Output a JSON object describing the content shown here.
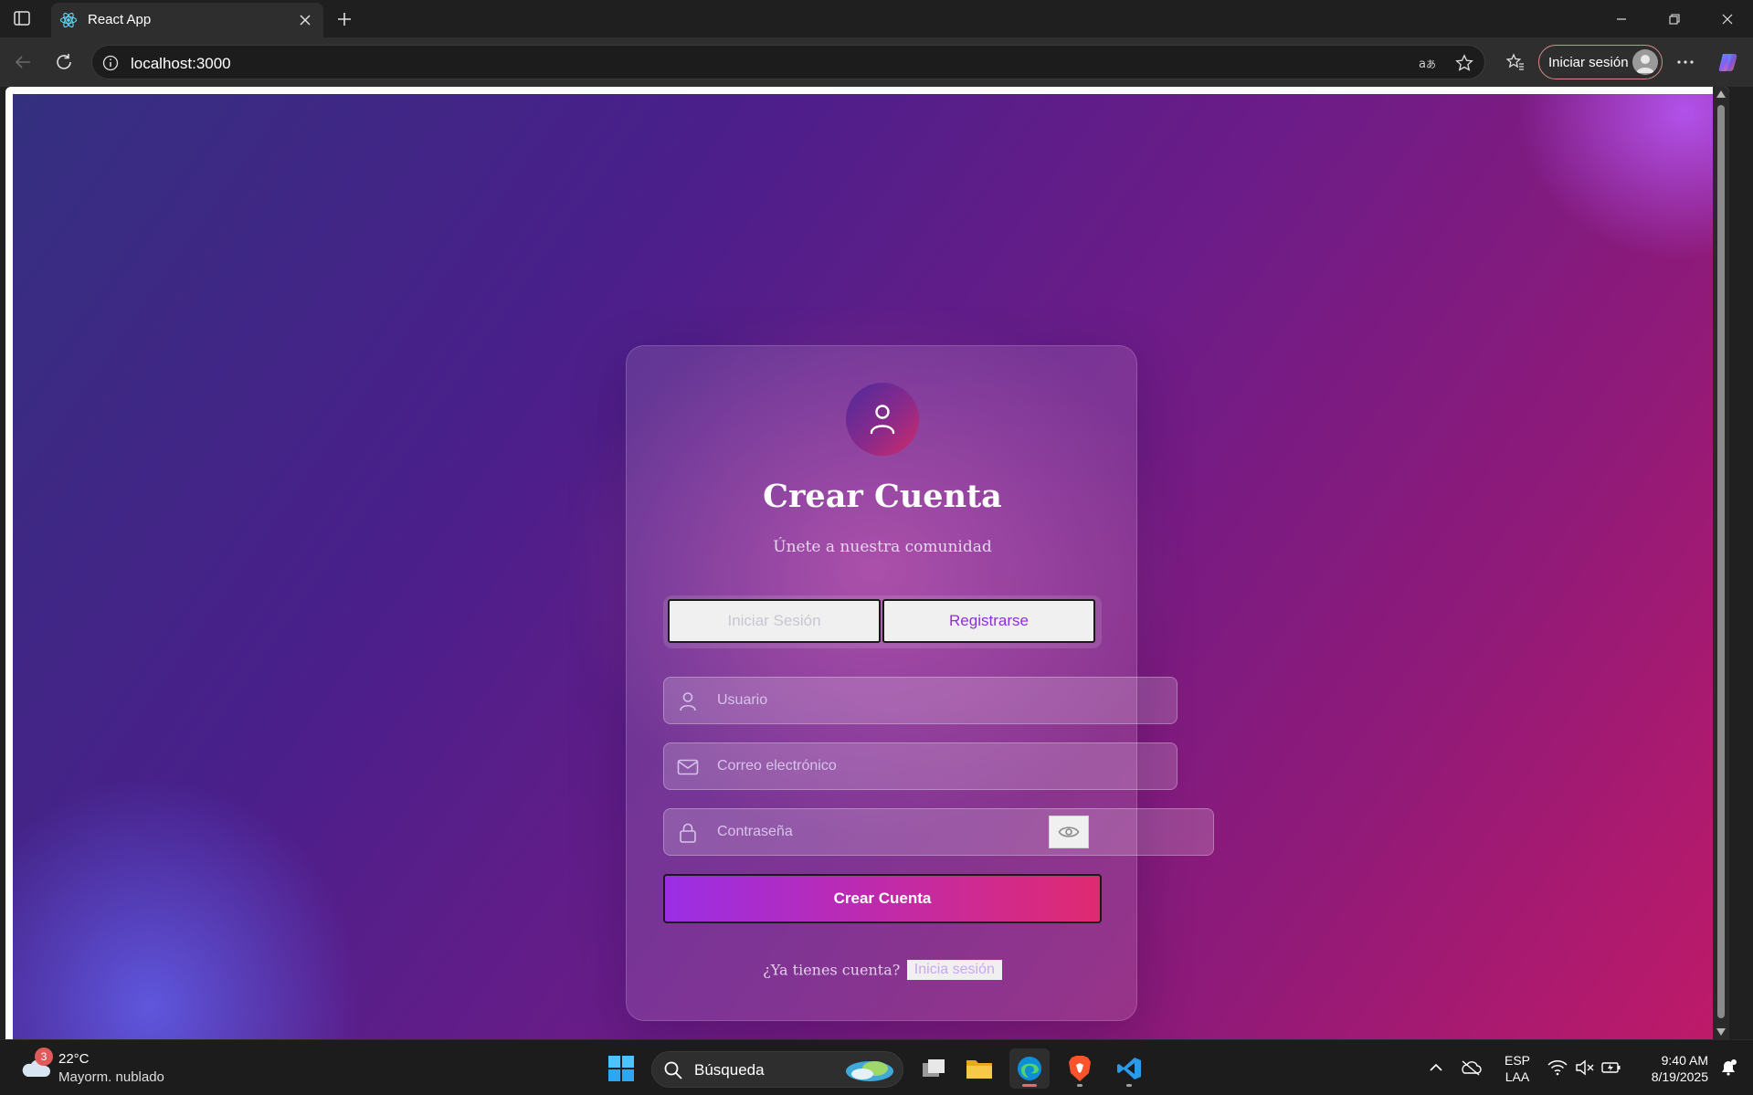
{
  "browser": {
    "tab_title": "React App",
    "url": "localhost:3000",
    "signin_label": "Iniciar sesión"
  },
  "card": {
    "title": "Crear Cuenta",
    "subtitle": "Únete a nuestra comunidad",
    "toggle": {
      "login_label": "Iniciar Sesión",
      "register_label": "Registrarse",
      "active": "register"
    },
    "fields": {
      "username_placeholder": "Usuario",
      "email_placeholder": "Correo electrónico",
      "password_placeholder": "Contraseña"
    },
    "submit_label": "Crear Cuenta",
    "footer_text": "¿Ya tienes cuenta?",
    "footer_link": "Inicia sesión"
  },
  "taskbar": {
    "weather_badge": "3",
    "weather_temp": "22°C",
    "weather_desc": "Mayorm. nublado",
    "search_placeholder": "Búsqueda",
    "lang_line1": "ESP",
    "lang_line2": "LAA",
    "time": "9:40 AM",
    "date": "8/19/2025"
  },
  "colors": {
    "accent_purple": "#8f2fdc",
    "gradient_start": "#9a2ee6",
    "gradient_end": "#e02a70"
  }
}
